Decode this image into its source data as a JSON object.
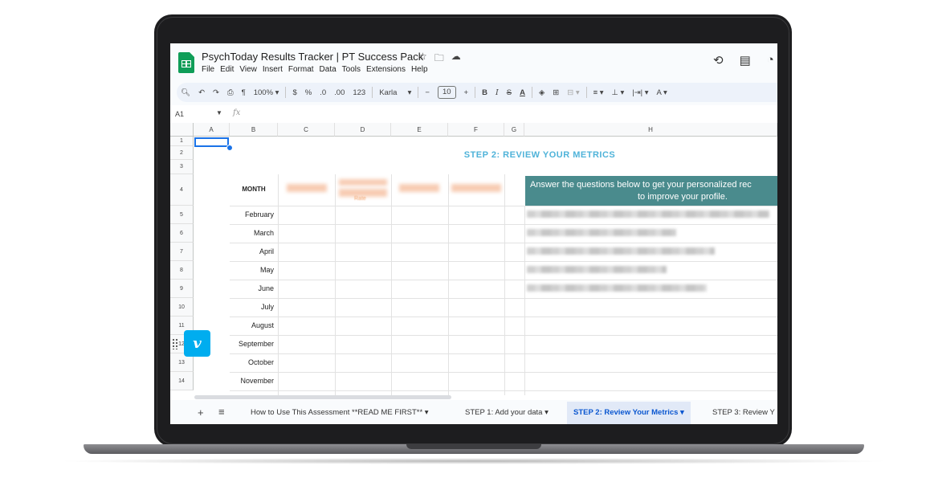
{
  "window": {
    "doc_title": "PsychToday Results Tracker | PT Success Pack",
    "title_icons": [
      "☆",
      "🗀",
      "☁"
    ],
    "menus": [
      "File",
      "Edit",
      "View",
      "Insert",
      "Format",
      "Data",
      "Tools",
      "Extensions",
      "Help"
    ],
    "top_right_icons": [
      "⟲",
      "▤",
      "◔"
    ]
  },
  "toolbar": {
    "zoom": "100%",
    "currency": "$",
    "percent": "%",
    "dec_decrease": ".0",
    "dec_increase": ".00",
    "number_format": "123",
    "font": "Karla",
    "font_size": "10",
    "bold": "B",
    "italic": "I",
    "strike": "S",
    "text_color": "A"
  },
  "formula_bar": {
    "cell_ref": "A1",
    "fx": "fx",
    "value": ""
  },
  "columns": [
    "A",
    "B",
    "C",
    "D",
    "E",
    "F",
    "G",
    "H"
  ],
  "rows": [
    "1",
    "2",
    "3",
    "4",
    "5",
    "6",
    "7",
    "8",
    "9",
    "10",
    "11",
    "12",
    "13",
    "14"
  ],
  "sheet": {
    "step_title": "STEP 2: REVIEW YOUR METRICS",
    "month_header": "MONTH",
    "months": [
      "February",
      "March",
      "April",
      "May",
      "June",
      "July",
      "August",
      "September",
      "October",
      "November"
    ],
    "blurred_label": "Rate",
    "callout_line1": "Answer the questions below to get your personalized rec",
    "callout_line2": "to improve your profile."
  },
  "tabs": {
    "add": "+",
    "menu": "≡",
    "items": [
      {
        "label": "How to Use This Assessment **READ ME FIRST** ▾"
      },
      {
        "label": "STEP 1: Add your data ▾"
      },
      {
        "label": "STEP 2: Review Your Metrics ▾"
      },
      {
        "label": "STEP 3: Review Y"
      }
    ]
  },
  "overlay": {
    "vimeo_letter": "v"
  },
  "colors": {
    "accent": "#1a73e8",
    "step_title": "#4fb3d9",
    "callout_bg": "#4a8b8d",
    "active_tab": "#0b57d0",
    "vimeo": "#00adef"
  }
}
